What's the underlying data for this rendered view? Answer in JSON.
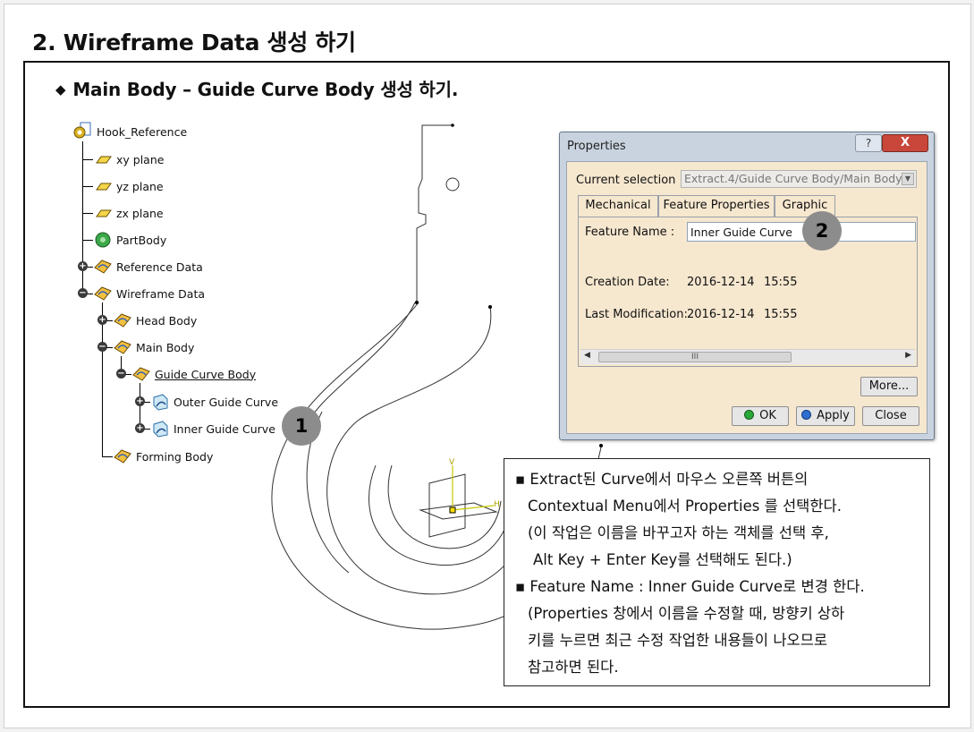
{
  "slide": {
    "title": "2. Wireframe Data 생성 하기",
    "subtitle_bullet": "◆",
    "subtitle": "Main Body – Guide Curve Body 생성 하기."
  },
  "tree": {
    "root": "Hook_Reference",
    "items": [
      {
        "label": "xy plane",
        "icon": "plane-icon"
      },
      {
        "label": "yz plane",
        "icon": "plane-icon"
      },
      {
        "label": "zx plane",
        "icon": "plane-icon"
      },
      {
        "label": "PartBody",
        "icon": "partbody-icon"
      },
      {
        "label": "Reference Data",
        "icon": "geometrical-set-icon"
      },
      {
        "label": "Wireframe Data",
        "icon": "geometrical-set-icon"
      },
      {
        "label": "Head Body",
        "icon": "geometrical-set-icon"
      },
      {
        "label": "Main Body",
        "icon": "geometrical-set-icon"
      },
      {
        "label": "Guide Curve Body",
        "icon": "geometrical-set-icon"
      },
      {
        "label": "Outer Guide Curve",
        "icon": "extract-icon"
      },
      {
        "label": "Inner Guide Curve",
        "icon": "extract-icon"
      },
      {
        "label": "Forming Body",
        "icon": "geometrical-set-icon"
      }
    ]
  },
  "dialog": {
    "title": "Properties",
    "help_label": "?",
    "close_label": "X",
    "current_selection_label": "Current selection :",
    "current_selection_value": "Extract.4/Guide Curve Body/Main Body",
    "tabs": [
      "Mechanical",
      "Feature Properties",
      "Graphic"
    ],
    "active_tab": "Feature Properties",
    "feature_name_label": "Feature Name :",
    "feature_name_value": "Inner Guide Curve",
    "creation_date_label": "Creation Date:",
    "creation_date_value": "2016-12-14",
    "creation_time_value": "15:55",
    "last_mod_label": "Last Modification:",
    "last_mod_date_value": "2016-12-14",
    "last_mod_time_value": "15:55",
    "scroll_thumb": "III",
    "more_button": "More...",
    "ok_button": "OK",
    "apply_button": "Apply",
    "close_button": "Close"
  },
  "callouts": {
    "one": "1",
    "two": "2"
  },
  "axis_labels": {
    "v": "V",
    "h": "H"
  },
  "notes": [
    "▪ Extract된 Curve에서 마우스 오른쪽 버튼의",
    "Contextual Menu에서 Properties 를 선택한다.",
    "(이 작업은 이름을 바꾸고자 하는 객체를 선택 후,",
    "Alt Key + Enter Key를 선택해도 된다.)",
    "▪ Feature Name : Inner Guide Curve로 변경 한다.",
    "(Properties 창에서 이름을 수정할 때, 방향키 상하",
    "키를 누르면 최근 수정 작업한 내용들이 나오므로",
    "참고하면 된다."
  ],
  "colors": {
    "dialog_frame": "#c9d3e0",
    "dialog_panel": "#f6e7cf",
    "close_red": "#c9473a",
    "ok_green": "#2aa83a",
    "apply_blue": "#2f6fd0",
    "callout_gray": "#8c8c8c"
  }
}
